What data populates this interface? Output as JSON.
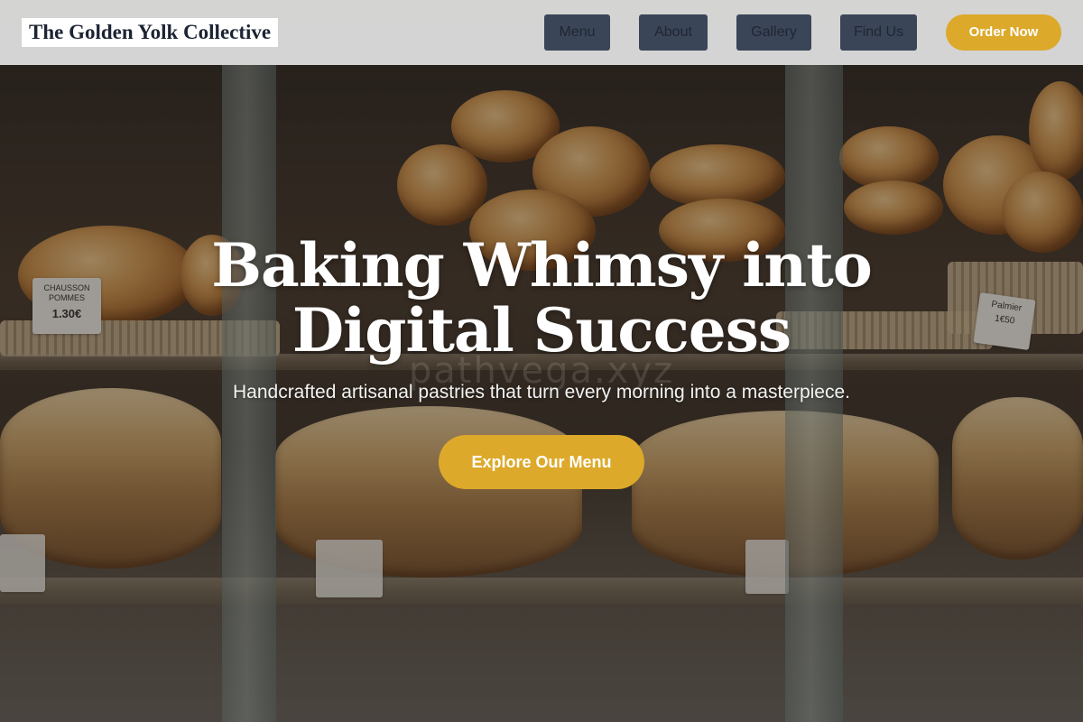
{
  "header": {
    "logo_text": "The Golden Yolk Collective",
    "nav": [
      {
        "label": "Menu"
      },
      {
        "label": "About"
      },
      {
        "label": "Gallery"
      },
      {
        "label": "Find Us"
      }
    ],
    "order_label": "Order Now"
  },
  "hero": {
    "title": "Baking Whimsy into Digital Success",
    "subtitle": "Handcrafted artisanal pastries that turn every morning into a masterpiece.",
    "cta_label": "Explore Our Menu",
    "background_image": {
      "price_cards": [
        {
          "name": "CHAUSSON POMMES",
          "price": "1.30€"
        },
        {
          "name": "Palmier",
          "price": "1€50"
        }
      ],
      "watermark_text": "pathvega.xyz"
    }
  },
  "colors": {
    "accent": "#dca92a",
    "nav_button": "#3b4558",
    "header_bg": "#e2e2e2",
    "logo_text": "#1c2433"
  }
}
